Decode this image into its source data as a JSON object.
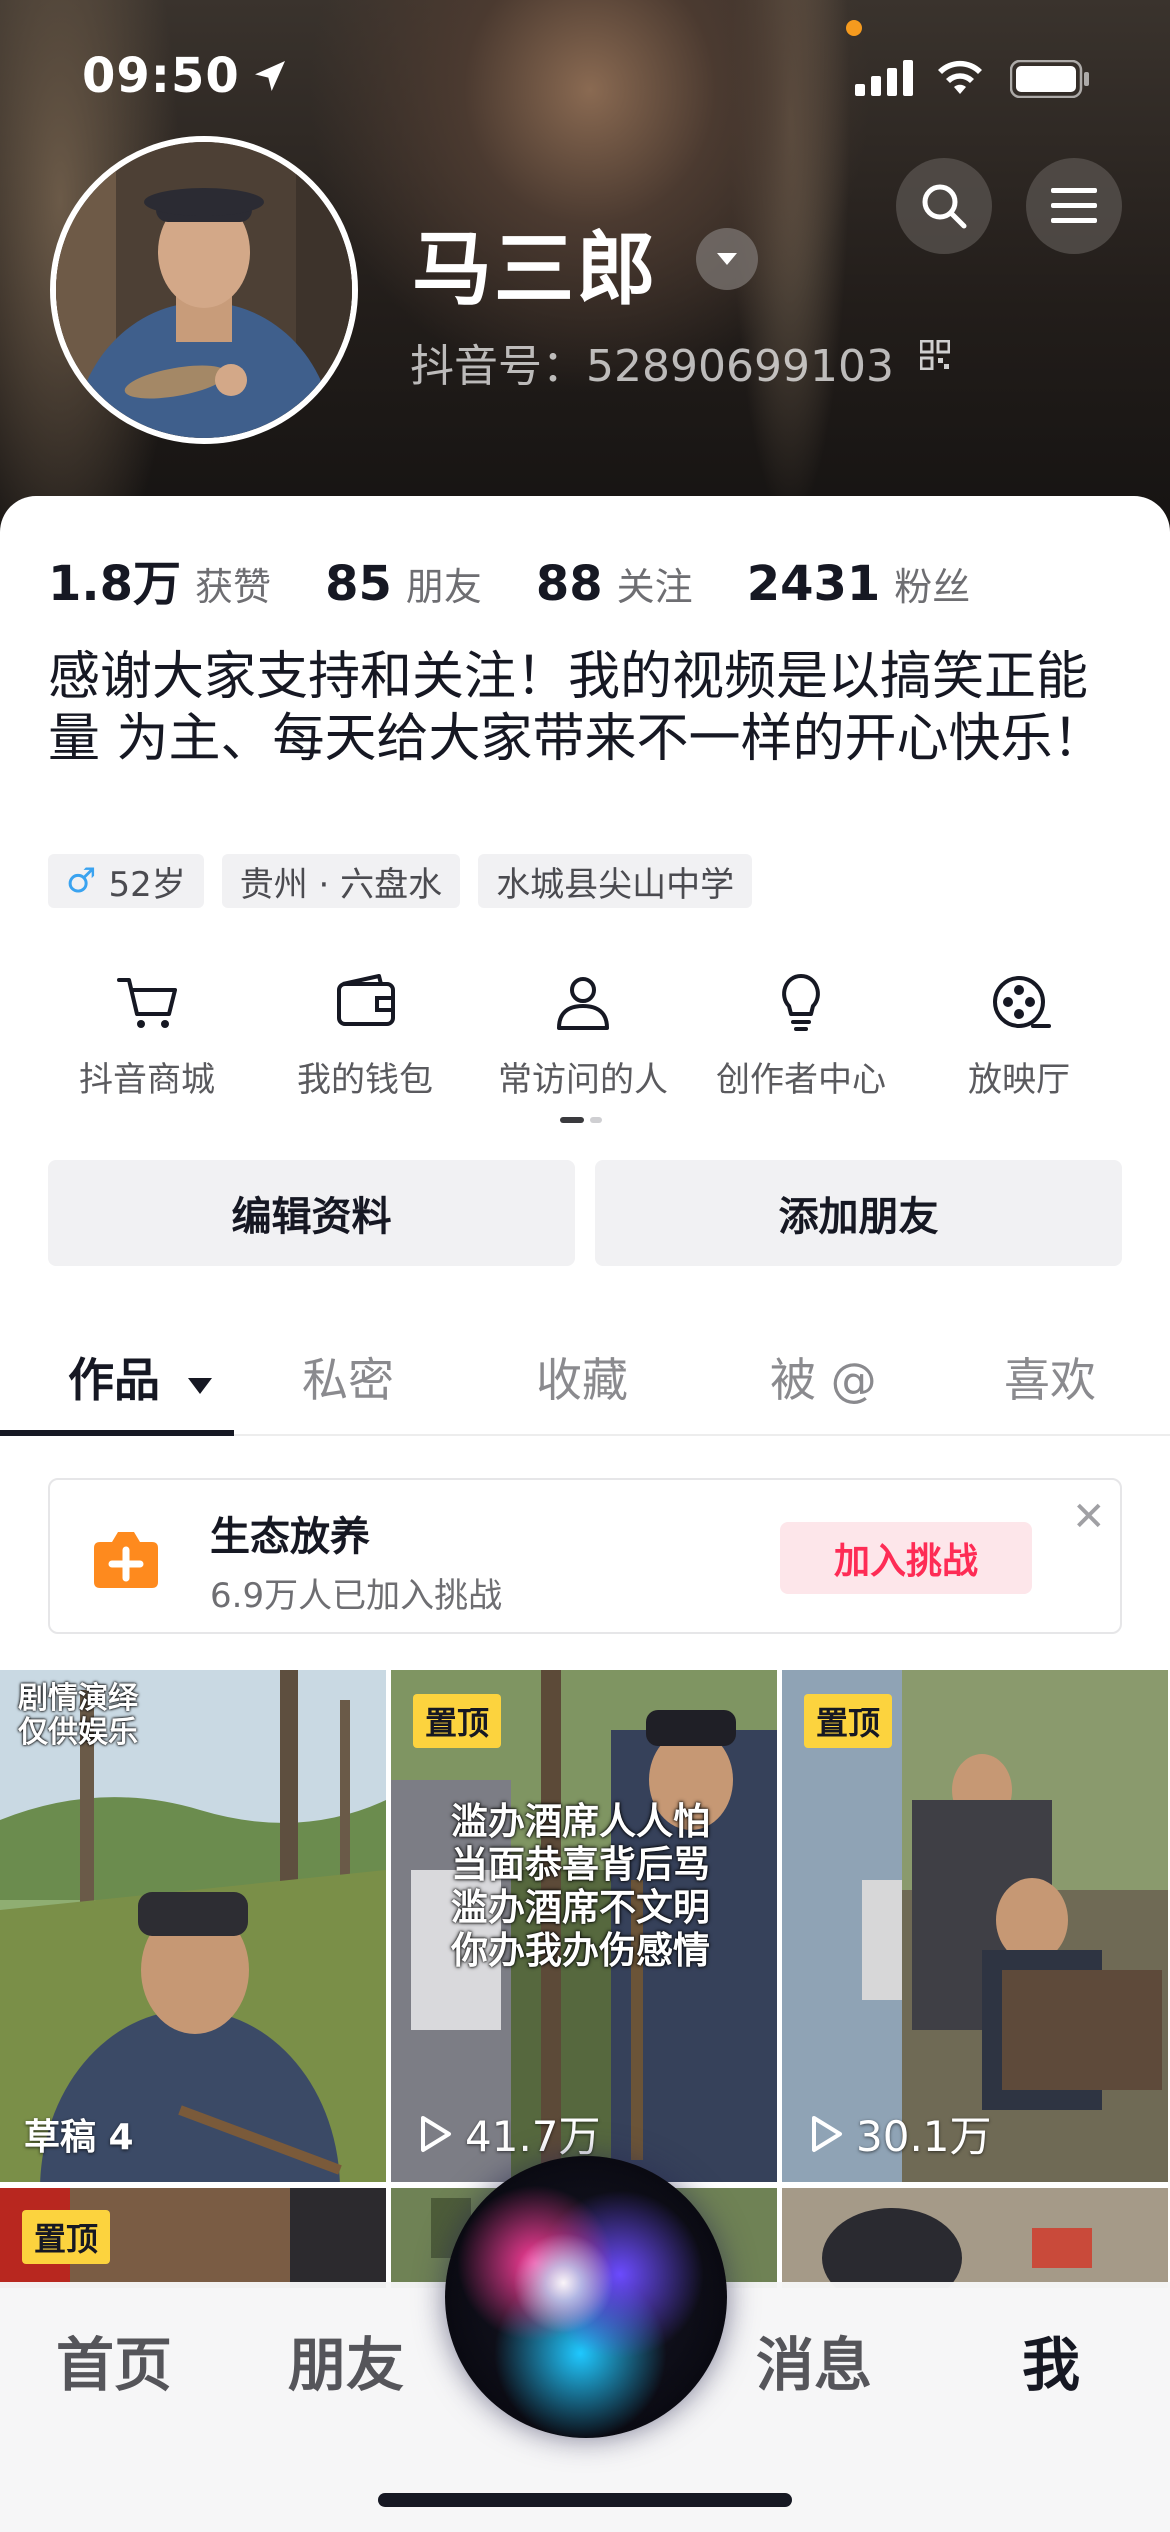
{
  "status_bar": {
    "time": "09:50"
  },
  "profile": {
    "name": "马三郎",
    "douyin_id": "抖音号：52890699103",
    "stats": [
      {
        "value": "1.8万",
        "label": "获赞"
      },
      {
        "value": "85",
        "label": "朋友"
      },
      {
        "value": "88",
        "label": "关注"
      },
      {
        "value": "2431",
        "label": "粉丝"
      }
    ],
    "bio": "感谢大家支持和关注！我的视频是以搞笑正能量 为主、每天给大家带来不一样的开心快乐！",
    "tags": {
      "gender_symbol": "♂",
      "age": "52岁",
      "location": "贵州 · 六盘水",
      "school": "水城县尖山中学"
    }
  },
  "shortcuts": [
    {
      "label": "抖音商城",
      "icon": "cart-icon"
    },
    {
      "label": "我的钱包",
      "icon": "wallet-icon"
    },
    {
      "label": "常访问的人",
      "icon": "person-icon"
    },
    {
      "label": "创作者中心",
      "icon": "lightbulb-icon"
    },
    {
      "label": "放映厅",
      "icon": "film-reel-icon"
    }
  ],
  "actions": {
    "edit_profile": "编辑资料",
    "add_friend": "添加朋友"
  },
  "tabs": [
    {
      "label": "作品",
      "active": true
    },
    {
      "label": "私密"
    },
    {
      "label": "收藏"
    },
    {
      "label": "被 @"
    },
    {
      "label": "喜欢"
    }
  ],
  "challenge": {
    "title": "生态放养",
    "subtitle": "6.9万人已加入挑战",
    "join_label": "加入挑战"
  },
  "grid": {
    "cell1": {
      "note_line1": "剧情演绎",
      "note_line2": "仅供娱乐",
      "draft": "草稿 4"
    },
    "cell2": {
      "pin": "置顶",
      "line1": "滥办酒席人人怕",
      "line2": "当面恭喜背后骂",
      "line3": "滥办酒席不文明",
      "line4": "你办我办伤感情",
      "plays": "41.7万"
    },
    "cell3": {
      "pin": "置顶",
      "plays": "30.1万"
    },
    "cell4": {
      "pin": "置顶"
    }
  },
  "bottom_nav": {
    "home": "首页",
    "friends": "朋友",
    "messages": "消息",
    "me": "我"
  },
  "colors": {
    "accent": "#fe2c55",
    "pin_yellow": "#fcd33e",
    "male_blue": "#3aa3f0"
  }
}
